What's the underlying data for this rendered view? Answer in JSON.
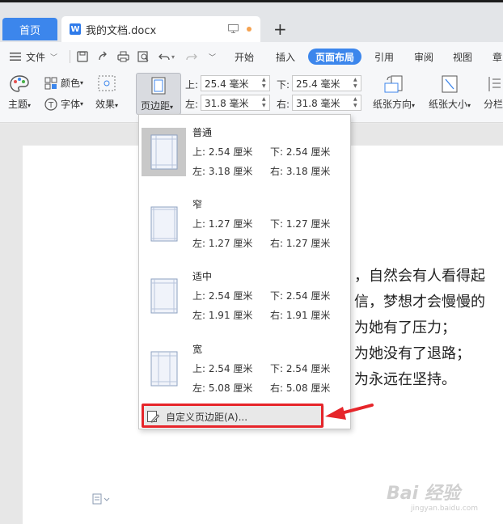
{
  "tabs": {
    "home": "首页",
    "doc_title": "我的文档.docx",
    "doc_icon": "W",
    "new_tab": "+"
  },
  "toolbar": {
    "file_menu": "文件",
    "ribbon_tabs": [
      "开始",
      "插入",
      "页面布局",
      "引用",
      "审阅",
      "视图",
      "章"
    ],
    "active_tab": "页面布局",
    "theme": "主题",
    "color": "颜色",
    "font": "字体",
    "effect": "效果",
    "margins": "页边距",
    "orientation": "纸张方向",
    "size": "纸张大小",
    "columns": "分栏",
    "top_label": "上:",
    "bottom_label": "下:",
    "left_label": "左:",
    "right_label": "右:",
    "top_value": "25.4 毫米",
    "bottom_value": "25.4 毫米",
    "left_value": "31.8 毫米",
    "right_value": "31.8 毫米"
  },
  "margin_presets": [
    {
      "name": "普通",
      "top": "上: 2.54 厘米",
      "bottom": "下: 2.54 厘米",
      "left": "左: 3.18 厘米",
      "right": "右: 3.18 厘米"
    },
    {
      "name": "窄",
      "top": "上: 1.27 厘米",
      "bottom": "下: 1.27 厘米",
      "left": "左: 1.27 厘米",
      "right": "右: 1.27 厘米"
    },
    {
      "name": "适中",
      "top": "上: 2.54 厘米",
      "bottom": "下: 2.54 厘米",
      "left": "左: 1.91 厘米",
      "right": "右: 1.91 厘米"
    },
    {
      "name": "宽",
      "top": "上: 2.54 厘米",
      "bottom": "下: 2.54 厘米",
      "left": "左: 5.08 厘米",
      "right": "右: 5.08 厘米"
    }
  ],
  "custom_margins": "自定义页边距(A)...",
  "document": {
    "lines": [
      "，自然会有人看得起",
      "信，梦想才会慢慢的",
      "为她有了压力；",
      "为她没有了退路；",
      "为永远在坚持。"
    ]
  },
  "watermark": {
    "text": "Bai 经验",
    "url": "jingyan.baidu.com"
  },
  "colors": {
    "accent": "#3c86ec",
    "highlight": "#e6252a"
  }
}
